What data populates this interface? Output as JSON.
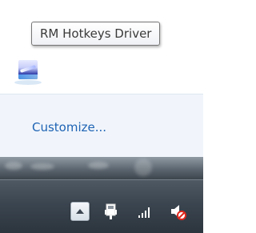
{
  "tooltip": {
    "text": "RM Hotkeys Driver"
  },
  "overflow_popup": {
    "icons": [
      {
        "name": "rm-hotkeys-driver-icon"
      }
    ],
    "customize_label": "Customize..."
  },
  "taskbar": {
    "tray_icons": [
      "show-hidden-icons-button",
      "power-plug-icon",
      "network-signal-icon",
      "volume-muted-icon"
    ]
  },
  "colors": {
    "link": "#1e63b4",
    "footer_bg": "#f1f5fb",
    "taskbar_bg": "#3b4550",
    "mute_red": "#e0261c"
  }
}
